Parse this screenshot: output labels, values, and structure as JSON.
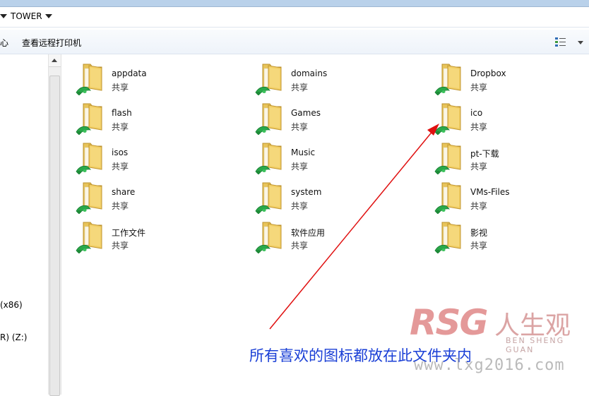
{
  "address": {
    "partial_caret": "▼",
    "location": "TOWER"
  },
  "toolbar": {
    "partial_item": "心",
    "view_remote_printers": "查看远程打印机"
  },
  "nav": {
    "item1": "(x86)",
    "item2": "R) (Z:)"
  },
  "folders": [
    {
      "name": "appdata",
      "status": "共享"
    },
    {
      "name": "domains",
      "status": "共享"
    },
    {
      "name": "Dropbox",
      "status": "共享"
    },
    {
      "name": "flash",
      "status": "共享"
    },
    {
      "name": "Games",
      "status": "共享"
    },
    {
      "name": "ico",
      "status": "共享"
    },
    {
      "name": "isos",
      "status": "共享"
    },
    {
      "name": "Music",
      "status": "共享"
    },
    {
      "name": "pt-下载",
      "status": "共享"
    },
    {
      "name": "share",
      "status": "共享"
    },
    {
      "name": "system",
      "status": "共享"
    },
    {
      "name": "VMs-Files",
      "status": "共享"
    },
    {
      "name": "工作文件",
      "status": "共享"
    },
    {
      "name": "软件应用",
      "status": "共享"
    },
    {
      "name": "影视",
      "status": "共享"
    }
  ],
  "annotation": {
    "text": "所有喜欢的图标都放在此文件夹内",
    "color": "#1a3fd6",
    "arrow_color": "#e01010"
  },
  "watermark": {
    "logo": "RSG",
    "chinese": "人生观",
    "pinyin": "BEN SHENG GUAN",
    "url": "www.lxg2016.com"
  }
}
